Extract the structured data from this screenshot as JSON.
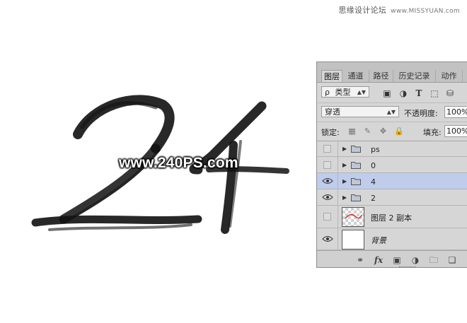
{
  "site_header": {
    "text": "思缘设计论坛",
    "url_text": "www.MISSYUAN.com"
  },
  "watermark": "www.240PS.com",
  "panel": {
    "tabs": [
      {
        "label": "图层",
        "active": true
      },
      {
        "label": "通道",
        "active": false
      },
      {
        "label": "路径",
        "active": false
      },
      {
        "label": "历史记录",
        "active": false
      },
      {
        "label": "动作",
        "active": false
      }
    ],
    "filter": {
      "search_glyph": "ρ",
      "kind_label": "类型"
    },
    "blend_mode": "穿透",
    "opacity_label": "不透明度:",
    "opacity_value": "100%",
    "lock_label": "锁定:",
    "fill_label": "填充:",
    "fill_value": "100%",
    "layers": [
      {
        "name": "ps",
        "type": "group",
        "visible": false,
        "selected": false
      },
      {
        "name": "0",
        "type": "group",
        "visible": false,
        "selected": false
      },
      {
        "name": "4",
        "type": "group",
        "visible": true,
        "selected": true
      },
      {
        "name": "2",
        "type": "group",
        "visible": true,
        "selected": false
      },
      {
        "name": "图层 2 副本",
        "type": "pixel",
        "visible": false,
        "selected": false
      },
      {
        "name": "背景",
        "type": "background",
        "visible": true,
        "selected": false
      }
    ]
  },
  "colors": {
    "panel_bg": "#d6d6d6",
    "selected_row": "#c0ccec",
    "canvas_bg": "#ffffff"
  }
}
